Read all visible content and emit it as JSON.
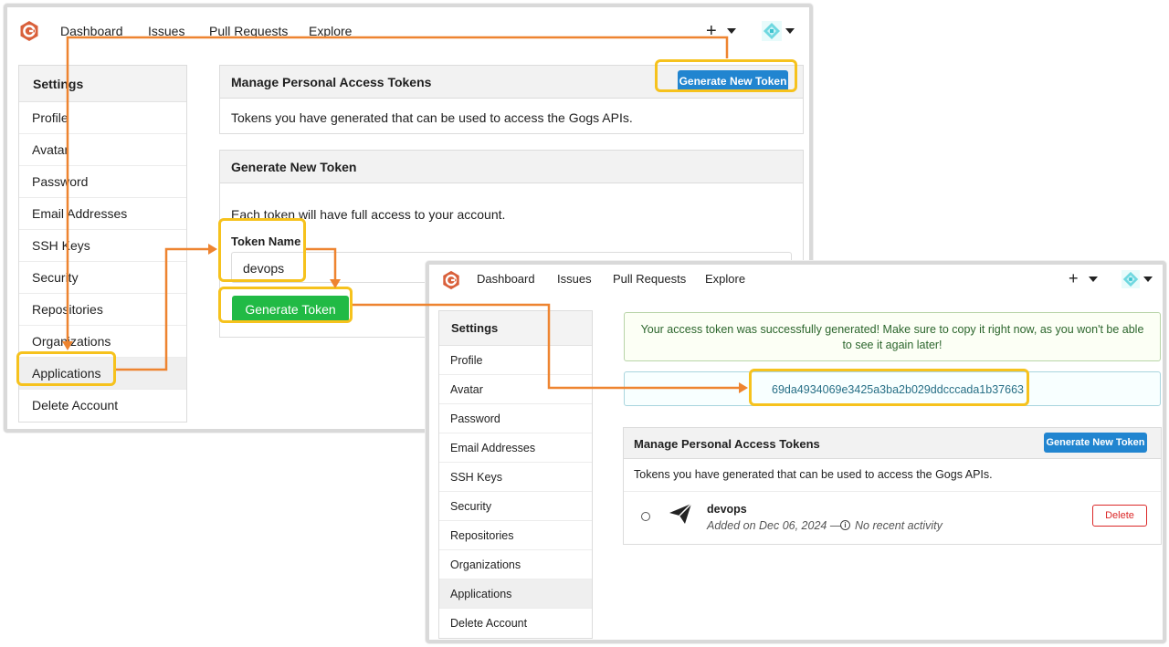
{
  "nav": {
    "items": [
      "Dashboard",
      "Issues",
      "Pull Requests",
      "Explore"
    ],
    "plus": "+"
  },
  "menu": {
    "header": "Settings",
    "items": [
      "Profile",
      "Avatar",
      "Password",
      "Email Addresses",
      "SSH Keys",
      "Security",
      "Repositories",
      "Organizations",
      "Applications",
      "Delete Account"
    ]
  },
  "manage": {
    "title": "Manage Personal Access Tokens",
    "button": "Generate New Token",
    "description": "Tokens you have generated that can be used to access the Gogs APIs."
  },
  "generate": {
    "title": "Generate New Token",
    "info": "Each token will have full access to your account.",
    "name_label": "Token Name",
    "name_value": "devops",
    "button": "Generate Token"
  },
  "result": {
    "success_message": "Your access token was successfully generated! Make sure to copy it right now, as you won't be able to see it again later!",
    "token": "69da4934069e3425a3ba2b029ddcccada1b37663"
  },
  "token_item": {
    "name": "devops",
    "added": "Added on Dec 06, 2024 —",
    "activity": "No recent activity",
    "delete": "Delete"
  },
  "colors": {
    "accent_blue": "#2185d0",
    "green": "#21ba45",
    "highlight": "#f6c21d",
    "arrow": "#ee8430",
    "delete_red": "#db2828",
    "logo": "#d9603b"
  }
}
